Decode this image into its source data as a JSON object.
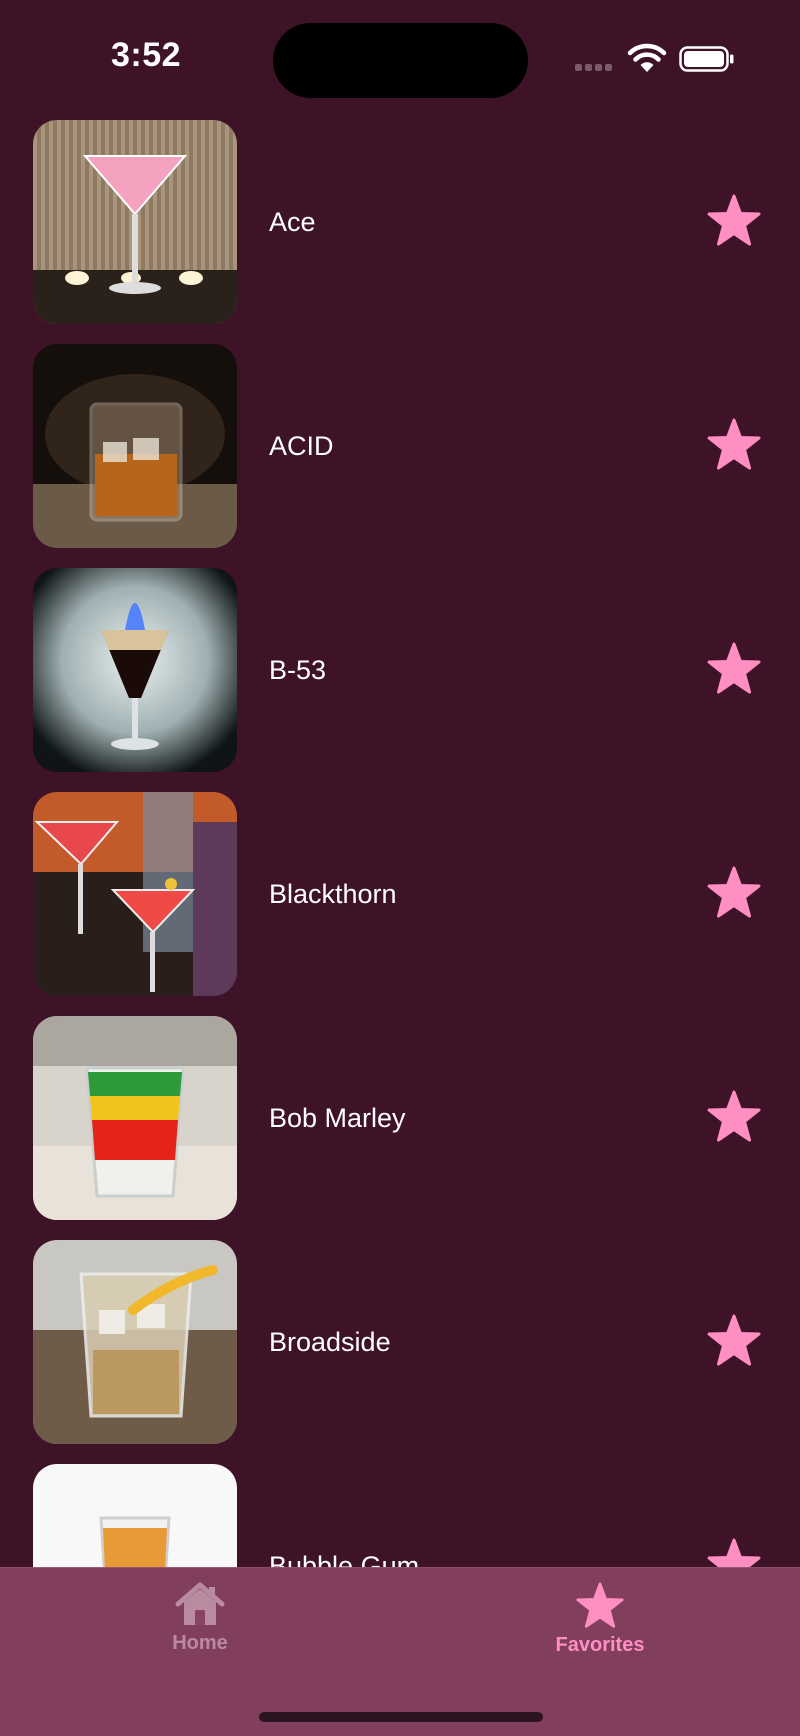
{
  "status_bar": {
    "time": "3:52"
  },
  "list": {
    "items": [
      {
        "name": "Ace"
      },
      {
        "name": "ACID"
      },
      {
        "name": "B-53"
      },
      {
        "name": "Blackthorn"
      },
      {
        "name": "Bob Marley"
      },
      {
        "name": "Broadside"
      },
      {
        "name": "Bubble Gum"
      }
    ]
  },
  "tab_bar": {
    "home_label": "Home",
    "favorites_label": "Favorites",
    "selected": "Favorites"
  },
  "icons": {
    "favorite": "star-icon",
    "home": "house-icon"
  },
  "colors": {
    "background": "#3e1227",
    "accent": "#ff8ec3",
    "tab_bar": "#884262",
    "tab_inactive": "#b98aa0"
  }
}
